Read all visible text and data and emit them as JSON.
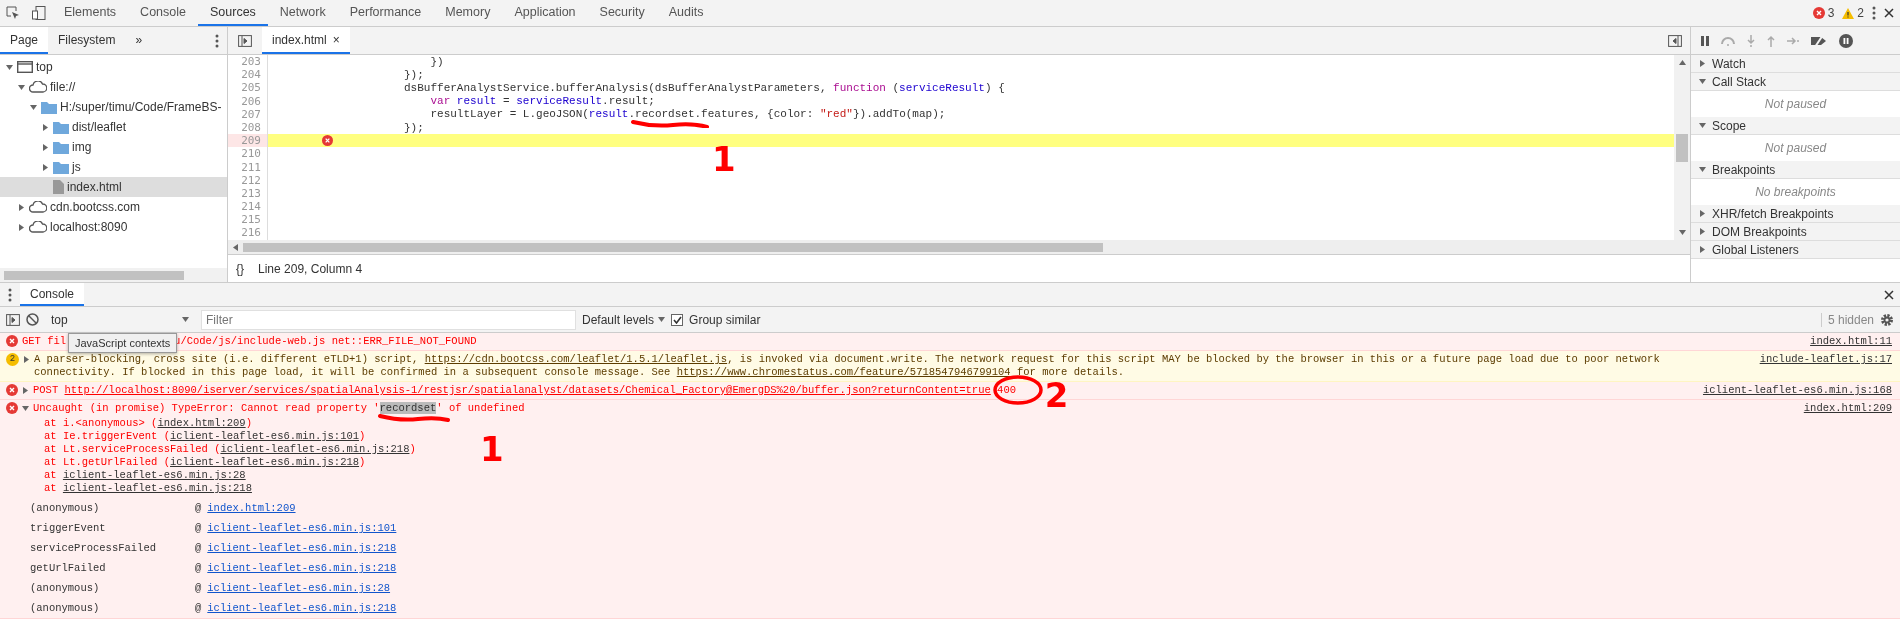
{
  "toolbar": {
    "tabs": [
      {
        "label": "Elements",
        "selected": false
      },
      {
        "label": "Console",
        "selected": false
      },
      {
        "label": "Sources",
        "selected": true
      },
      {
        "label": "Network",
        "selected": false
      },
      {
        "label": "Performance",
        "selected": false
      },
      {
        "label": "Memory",
        "selected": false
      },
      {
        "label": "Application",
        "selected": false
      },
      {
        "label": "Security",
        "selected": false
      },
      {
        "label": "Audits",
        "selected": false
      }
    ],
    "error_count": "3",
    "warning_count": "2"
  },
  "navigator": {
    "tabs": [
      {
        "label": "Page",
        "selected": true
      },
      {
        "label": "Filesystem",
        "selected": false
      }
    ],
    "more": "»",
    "tree": [
      {
        "label": "top",
        "kind": "frame",
        "expanded": true,
        "selected": false,
        "children": [
          {
            "label": "file://",
            "kind": "origin",
            "expanded": true,
            "selected": false,
            "children": [
              {
                "label": "H:/super/timu/Code/FrameBS-",
                "kind": "folder",
                "expanded": true,
                "selected": false,
                "children": [
                  {
                    "label": "dist/leaflet",
                    "kind": "folder",
                    "expanded": false,
                    "selected": false
                  },
                  {
                    "label": "img",
                    "kind": "folder",
                    "expanded": false,
                    "selected": false
                  },
                  {
                    "label": "js",
                    "kind": "folder",
                    "expanded": false,
                    "selected": false
                  },
                  {
                    "label": "index.html",
                    "kind": "file",
                    "selected": true
                  }
                ]
              }
            ]
          },
          {
            "label": "cdn.bootcss.com",
            "kind": "origin",
            "expanded": false,
            "selected": false
          },
          {
            "label": "localhost:8090",
            "kind": "origin",
            "expanded": false,
            "selected": false
          }
        ]
      }
    ]
  },
  "editor": {
    "tab": {
      "label": "index.html",
      "close": "×"
    },
    "lines": [
      {
        "number": "203",
        "error": false,
        "tokens": [
          {
            "text": "                        })",
            "kind": "plain"
          }
        ]
      },
      {
        "number": "204",
        "error": false,
        "tokens": [
          {
            "text": "                    });",
            "kind": "plain"
          }
        ]
      },
      {
        "number": "205",
        "error": false,
        "tokens": [
          {
            "text": "                    dsBufferAnalystService.bufferAnalysis(dsBufferAnalystParameters, ",
            "kind": "plain"
          },
          {
            "text": "function",
            "kind": "keyword"
          },
          {
            "text": " (",
            "kind": "plain"
          },
          {
            "text": "serviceResult",
            "kind": "name"
          },
          {
            "text": ") {",
            "kind": "plain"
          }
        ]
      },
      {
        "number": "206",
        "error": false,
        "tokens": [
          {
            "text": "                        var",
            "kind": "keyword"
          },
          {
            "text": " result",
            "kind": "name"
          },
          {
            "text": " = ",
            "kind": "plain"
          },
          {
            "text": "serviceResult",
            "kind": "name"
          },
          {
            "text": ".result;",
            "kind": "plain"
          }
        ]
      },
      {
        "number": "207",
        "error": false,
        "tokens": [
          {
            "text": "                        resultLayer = L.geoJSON(",
            "kind": "plain"
          },
          {
            "text": "result",
            "kind": "name"
          },
          {
            "text": ".",
            "kind": "plain"
          },
          {
            "text": "recordset",
            "kind": "annotated"
          },
          {
            "text": ".features, {color: ",
            "kind": "plain"
          },
          {
            "text": "\"red\"",
            "kind": "string"
          },
          {
            "text": "}).addTo(map);",
            "kind": "plain"
          }
        ]
      },
      {
        "number": "208",
        "error": false,
        "tokens": [
          {
            "text": "                    });",
            "kind": "plain"
          }
        ]
      },
      {
        "number": "209",
        "error": true
      },
      {
        "number": "210",
        "error": false
      },
      {
        "number": "211",
        "error": false
      },
      {
        "number": "212",
        "error": false
      },
      {
        "number": "213",
        "error": false
      },
      {
        "number": "214",
        "error": false
      },
      {
        "number": "215",
        "error": false
      },
      {
        "number": "216",
        "error": false
      }
    ],
    "status": {
      "braces": "{}",
      "position": "Line 209, Column 4"
    }
  },
  "debugger": {
    "sections": [
      {
        "title": "Watch",
        "expanded": false
      },
      {
        "title": "Call Stack",
        "expanded": true,
        "body": "Not paused"
      },
      {
        "title": "Scope",
        "expanded": true,
        "body": "Not paused"
      },
      {
        "title": "Breakpoints",
        "expanded": true,
        "body": "No breakpoints"
      },
      {
        "title": "XHR/fetch Breakpoints",
        "expanded": false
      },
      {
        "title": "DOM Breakpoints",
        "expanded": false
      },
      {
        "title": "Global Listeners",
        "expanded": false
      }
    ]
  },
  "drawer": {
    "tab": {
      "label": "Console",
      "selected": true
    },
    "toolbar": {
      "context": "top",
      "filter_placeholder": "Filter",
      "levels": "Default levels",
      "group_similar": {
        "label": "Group similar",
        "checked": true
      },
      "hidden": "5 hidden"
    },
    "tooltip": "JavaScript contexts",
    "messages": [
      {
        "kind": "error",
        "parts": [
          {
            "text": "GET fil",
            "kind": "text"
          },
          {
            "text": "u/Code/js/include-web.js net::ERR_FILE_NOT_FOUND",
            "kind": "tail"
          }
        ],
        "source": "index.html:11"
      },
      {
        "kind": "warning",
        "count": "2",
        "expanded": false,
        "parts": [
          {
            "text": "A parser-blocking, cross site (i.e. different eTLD+1) script, ",
            "kind": "text"
          },
          {
            "text": "https://cdn.bootcss.com/leaflet/1.5.1/leaflet.js",
            "kind": "link"
          },
          {
            "text": ", is invoked via document.write. The network request for this script MAY be blocked by the browser in this or a future page load due to poor network connectivity. If blocked in this page load, it will be confirmed in a subsequent console message. See ",
            "kind": "text"
          },
          {
            "text": "https://www.chromestatus.com/feature/5718547946799104",
            "kind": "link"
          },
          {
            "text": " for more details.",
            "kind": "text"
          }
        ],
        "source": "include-leaflet.js:17"
      },
      {
        "kind": "error",
        "expanded": false,
        "parts": [
          {
            "text": "POST ",
            "kind": "text"
          },
          {
            "text": "http://localhost:8090/iserver/services/spatialAnalysis-1/restjsr/spatialanalyst/datasets/Chemical_Factory@EmergDS%20/buffer.json?returnContent=true",
            "kind": "link"
          },
          {
            "text": " 400",
            "kind": "status"
          }
        ],
        "source": "iclient-leaflet-es6.min.js:168"
      },
      {
        "kind": "error",
        "expanded": true,
        "parts": [
          {
            "text": "Uncaught (in promise) TypeError: Cannot read property '",
            "kind": "text"
          },
          {
            "text": "recordset",
            "kind": "highlight"
          },
          {
            "text": "' of undefined",
            "kind": "text"
          }
        ],
        "source": "index.html:209",
        "stack": [
          {
            "text": "at i.<anonymous> (",
            "link": "index.html:209",
            "end": ")"
          },
          {
            "text": "at Ie.triggerEvent (",
            "link": "iclient-leaflet-es6.min.js:101",
            "end": ")"
          },
          {
            "text": "at Lt.serviceProcessFailed (",
            "link": "iclient-leaflet-es6.min.js:218",
            "end": ")"
          },
          {
            "text": "at Lt.getUrlFailed (",
            "link": "iclient-leaflet-es6.min.js:218",
            "end": ")"
          },
          {
            "text": "at ",
            "link": "iclient-leaflet-es6.min.js:28"
          },
          {
            "text": "at ",
            "link": "iclient-leaflet-es6.min.js:218"
          }
        ],
        "frames": [
          {
            "name": "(anonymous)",
            "at": "@",
            "link": "index.html:209"
          },
          {
            "name": "triggerEvent",
            "at": "@",
            "link": "iclient-leaflet-es6.min.js:101"
          },
          {
            "name": "serviceProcessFailed",
            "at": "@",
            "link": "iclient-leaflet-es6.min.js:218"
          },
          {
            "name": "getUrlFailed",
            "at": "@",
            "link": "iclient-leaflet-es6.min.js:218"
          },
          {
            "name": "(anonymous)",
            "at": "@",
            "link": "iclient-leaflet-es6.min.js:28"
          },
          {
            "name": "(anonymous)",
            "at": "@",
            "link": "iclient-leaflet-es6.min.js:218"
          }
        ]
      }
    ]
  },
  "annotations": [
    {
      "label": "1"
    },
    {
      "label": "2"
    },
    {
      "label": "1"
    }
  ]
}
